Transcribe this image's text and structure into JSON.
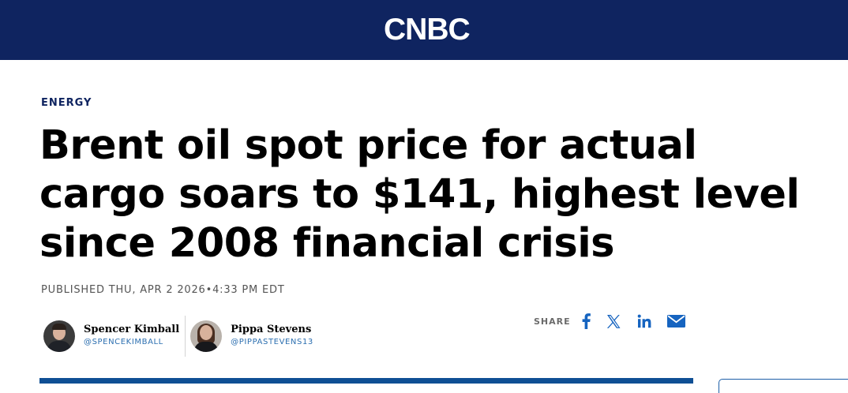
{
  "header": {
    "logo_text": "CNBC",
    "background_color": "#0f2460"
  },
  "article": {
    "category": "ENERGY",
    "headline": "Brent oil spot price for actual cargo soars to $141, highest level since 2008 financial crisis",
    "published": "PUBLISHED THU, APR 2 2026•4:33 PM EDT"
  },
  "authors": [
    {
      "name": "Spencer Kimball",
      "handle": "@SPENCEKIMBALL"
    },
    {
      "name": "Pippa Stevens",
      "handle": "@PIPPASTEVENS13"
    }
  ],
  "share": {
    "label": "SHARE",
    "icons": [
      "facebook-icon",
      "x-icon",
      "linkedin-icon",
      "email-icon"
    ],
    "icon_color": "#1664c0"
  },
  "colors": {
    "brand_navy": "#0f2460",
    "accent_blue": "#0f4f94",
    "link_blue": "#2c6fb0"
  }
}
